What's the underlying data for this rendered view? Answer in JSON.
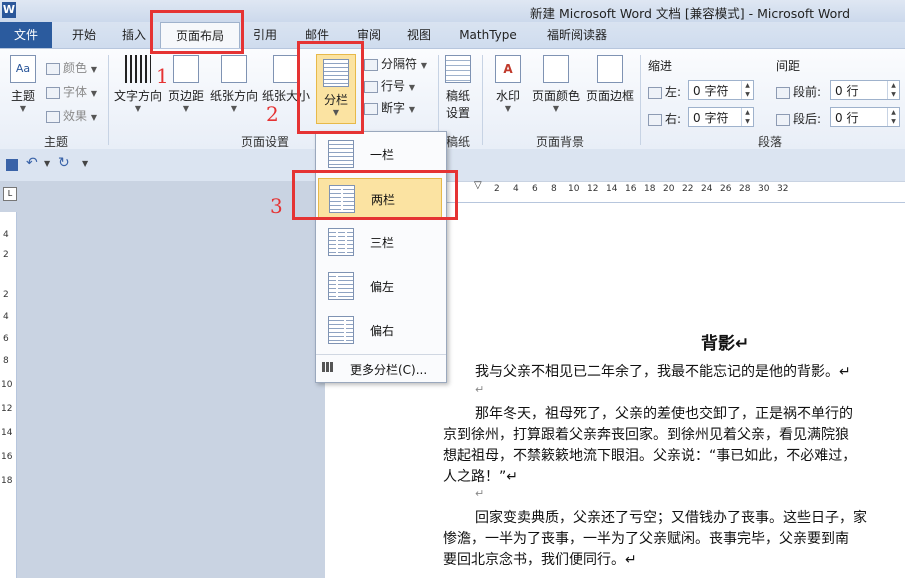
{
  "window": {
    "title": "新建 Microsoft Word 文档 [兼容模式] - Microsoft Word",
    "logo": "W"
  },
  "tabs": [
    "文件",
    "开始",
    "插入",
    "页面布局",
    "引用",
    "邮件",
    "审阅",
    "视图",
    "MathType",
    "福昕阅读器"
  ],
  "ribbon": {
    "theme_group": {
      "label": "主题",
      "theme_btn": "主题",
      "colors": "颜色",
      "fonts": "字体",
      "effects": "效果"
    },
    "page_setup_group": {
      "label": "页面设置",
      "text_direction": "文字方向",
      "margins": "页边距",
      "orientation": "纸张方向",
      "size": "纸张大小",
      "columns": "分栏",
      "breaks": "分隔符",
      "line_numbers": "行号",
      "hyphenation": "断字"
    },
    "manuscript_group": {
      "label": "稿纸",
      "btn1": "稿纸",
      "btn2": "设置"
    },
    "background_group": {
      "label": "页面背景",
      "watermark": "水印",
      "page_color": "页面颜色",
      "page_borders": "页面边框"
    },
    "paragraph_group": {
      "label": "段落",
      "indent": "缩进",
      "spacing": "间距",
      "left_label": "左:",
      "right_label": "右:",
      "before_label": "段前:",
      "after_label": "段后:",
      "left_value": "0 字符",
      "right_value": "0 字符",
      "before_value": "0 行",
      "after_value": "0 行"
    }
  },
  "columns_menu": {
    "items": [
      "一栏",
      "两栏",
      "三栏",
      "偏左",
      "偏右"
    ],
    "more": "更多分栏(C)..."
  },
  "annotations": {
    "n1": "1",
    "n2": "2",
    "n3": "3",
    "color": "#e53333"
  },
  "ruler_numbers": [
    "2",
    "4",
    "6",
    "8",
    "10",
    "12",
    "14",
    "16",
    "18",
    "20",
    "22",
    "24",
    "26",
    "28",
    "30",
    "32"
  ],
  "vruler_numbers": [
    "4",
    "2",
    "2",
    "4",
    "6",
    "8",
    "10",
    "12",
    "14",
    "16",
    "18"
  ],
  "document": {
    "title": "背影↵",
    "p1": "我与父亲不相见已二年余了，我最不能忘记的是他的背影。↵",
    "blank": "↵",
    "p2a": "那年冬天，祖母死了，父亲的差使也交卸了，正是祸不单行的",
    "p2b": "京到徐州，打算跟着父亲奔丧回家。到徐州见着父亲，看见满院狼",
    "p2c": "想起祖母，不禁簌簌地流下眼泪。父亲说：“事已如此，不必难过，",
    "p2d": "人之路！”↵",
    "p3a": "回家变卖典质，父亲还了亏空；又借钱办了丧事。这些日子，家",
    "p3b": "惨澹，一半为了丧事，一半为了父亲赋闲。丧事完毕，父亲要到南",
    "p3c": "要回北京念书，我们便同行。↵"
  }
}
